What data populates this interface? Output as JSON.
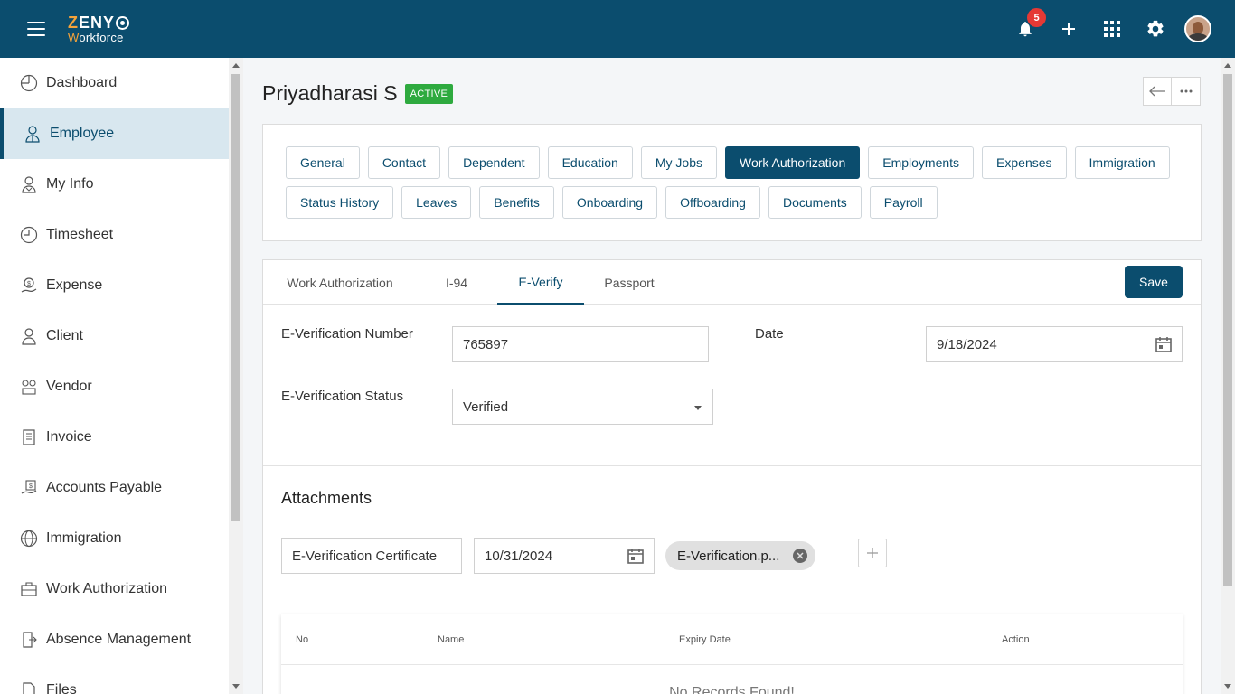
{
  "app": {
    "logo_top": "ZENY",
    "logo_bottom_first": "W",
    "logo_bottom_rest": "orkforce",
    "notification_count": "5"
  },
  "icons": {
    "menu": "menu-icon",
    "bell": "bell-icon",
    "plus": "plus-icon",
    "apps": "apps-grid-icon",
    "settings": "gear-icon"
  },
  "colors": {
    "brand": "#0b4d6e",
    "accent": "#f5a33a",
    "status_active": "#2eaa3f",
    "badge": "#e53935"
  },
  "sidebar": {
    "items": [
      {
        "label": "Dashboard",
        "icon": "dashboard-icon"
      },
      {
        "label": "Employee",
        "icon": "employee-icon",
        "active": true
      },
      {
        "label": "My Info",
        "icon": "my-info-icon"
      },
      {
        "label": "Timesheet",
        "icon": "clock-icon"
      },
      {
        "label": "Expense",
        "icon": "expense-icon"
      },
      {
        "label": "Client",
        "icon": "person-icon"
      },
      {
        "label": "Vendor",
        "icon": "vendor-icon"
      },
      {
        "label": "Invoice",
        "icon": "invoice-icon"
      },
      {
        "label": "Accounts Payable",
        "icon": "accounts-payable-icon"
      },
      {
        "label": "Immigration",
        "icon": "globe-icon"
      },
      {
        "label": "Work Authorization",
        "icon": "briefcase-icon"
      },
      {
        "label": "Absence Management",
        "icon": "exit-icon"
      },
      {
        "label": "Files",
        "icon": "file-icon"
      }
    ]
  },
  "header": {
    "name": "Priyadharasi S",
    "status": "ACTIVE"
  },
  "tabs": {
    "row1": [
      "General",
      "Contact",
      "Dependent",
      "Education",
      "My Jobs",
      "Work Authorization",
      "Employments",
      "Expenses",
      "Immigration"
    ],
    "row2": [
      "Status History",
      "Leaves",
      "Benefits",
      "Onboarding",
      "Offboarding",
      "Documents",
      "Payroll"
    ],
    "active": "Work Authorization"
  },
  "subtabs": {
    "items": [
      "Work Authorization",
      "I-94",
      "E-Verify",
      "Passport"
    ],
    "active": "E-Verify",
    "save_label": "Save"
  },
  "form": {
    "ever_number_label": "E-Verification Number",
    "ever_number_value": "765897",
    "date_label": "Date",
    "date_value": "9/18/2024",
    "ever_status_label": "E-Verification Status",
    "ever_status_value": "Verified"
  },
  "attachments": {
    "title": "Attachments",
    "doc_name": "E-Verification Certificate",
    "expiry": "10/31/2024",
    "file_chip": "E-Verification.p..."
  },
  "table": {
    "columns": [
      "No",
      "Name",
      "Expiry Date",
      "Action"
    ],
    "empty_message": "No Records Found!"
  }
}
